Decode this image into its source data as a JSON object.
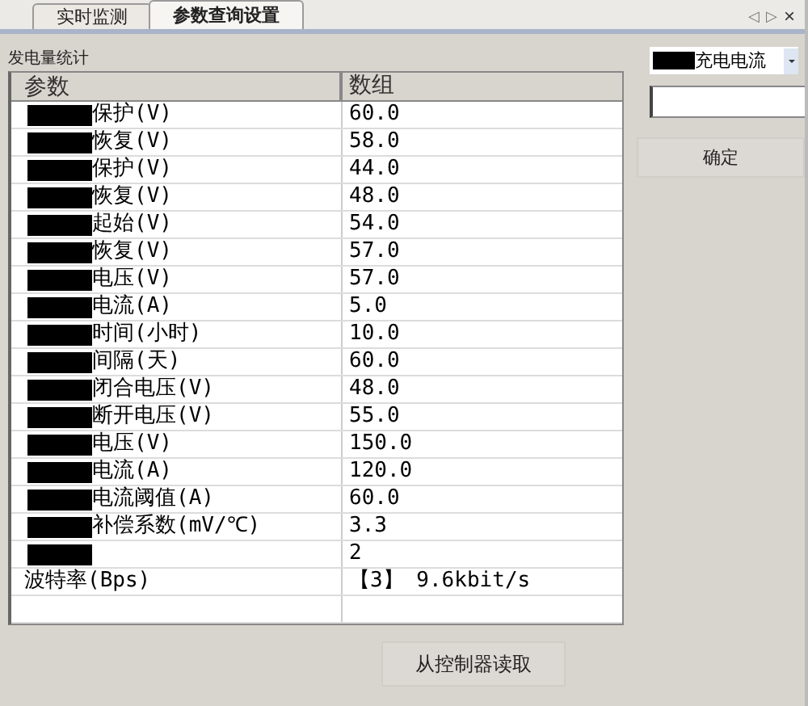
{
  "tabs": [
    {
      "label": "实时监测",
      "selected": false
    },
    {
      "label": "参数查询设置",
      "selected": true
    }
  ],
  "tab_nav": {
    "prev": "◁",
    "next": "▷",
    "close": "×"
  },
  "group_label": "发电量统计",
  "table": {
    "columns": [
      "参数",
      "数组"
    ],
    "rows": [
      {
        "param": "保护(V)",
        "value": "60.0",
        "redacted": true
      },
      {
        "param": "恢复(V)",
        "value": "58.0",
        "redacted": true
      },
      {
        "param": "保护(V)",
        "value": "44.0",
        "redacted": true
      },
      {
        "param": "恢复(V)",
        "value": "48.0",
        "redacted": true
      },
      {
        "param": "起始(V)",
        "value": "54.0",
        "redacted": true
      },
      {
        "param": "恢复(V)",
        "value": "57.0",
        "redacted": true
      },
      {
        "param": "电压(V)",
        "value": "57.0",
        "redacted": true
      },
      {
        "param": "电流(A)",
        "value": "5.0",
        "redacted": true
      },
      {
        "param": "时间(小时)",
        "value": "10.0",
        "redacted": true
      },
      {
        "param": "间隔(天)",
        "value": "60.0",
        "redacted": true
      },
      {
        "param": "闭合电压(V)",
        "value": "48.0",
        "redacted": true
      },
      {
        "param": "断开电压(V)",
        "value": "55.0",
        "redacted": true
      },
      {
        "param": "电压(V)",
        "value": "150.0",
        "redacted": true
      },
      {
        "param": "电流(A)",
        "value": "120.0",
        "redacted": true
      },
      {
        "param": "电流阈值(A)",
        "value": "60.0",
        "redacted": true
      },
      {
        "param": "补偿系数(mV/℃)",
        "value": "3.3",
        "redacted": true
      },
      {
        "value": "2",
        "redacted": true
      },
      {
        "param": "波特率(Bps)",
        "value": "【3】 9.6kbit/s",
        "redacted": false
      }
    ]
  },
  "dropdown": {
    "value": "充电电流",
    "redacted": true
  },
  "confirm_button": "确定",
  "read_button": "从控制器读取"
}
